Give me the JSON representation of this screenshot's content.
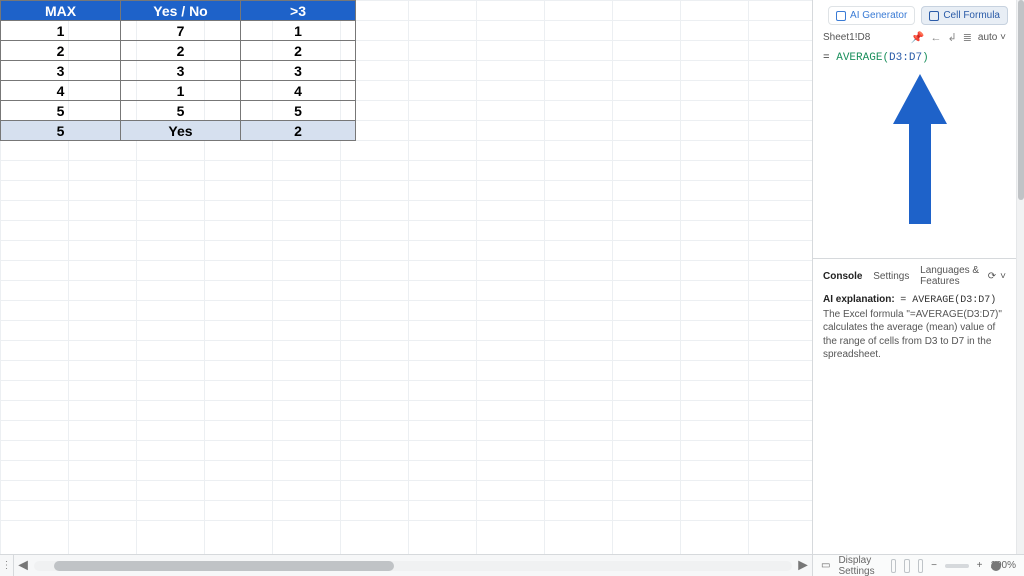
{
  "chart_data": {
    "type": "table",
    "headers": [
      "MAX",
      "Yes / No",
      ">3"
    ],
    "rows": [
      [
        "1",
        "7",
        "1"
      ],
      [
        "2",
        "2",
        "2"
      ],
      [
        "3",
        "3",
        "3"
      ],
      [
        "4",
        "1",
        "4"
      ],
      [
        "5",
        "5",
        "5"
      ],
      [
        "5",
        "Yes",
        "2"
      ]
    ],
    "highlight_row_index": 5
  },
  "side_panel": {
    "tabs": {
      "ai": "AI Generator",
      "cf": "Cell Formula"
    },
    "cell_ref": "Sheet1!D8",
    "auto_label": "auto",
    "formula": {
      "eq": "=",
      "fn": "AVERAGE",
      "open": "(",
      "arg": "D3:D7",
      "close": ")"
    },
    "console_tabs": {
      "console": "Console",
      "settings": "Settings",
      "lang": "Languages & Features"
    },
    "ai_explanation": {
      "label": "AI explanation:",
      "formula": "= AVERAGE(D3:D7)",
      "text": "The Excel formula \"=AVERAGE(D3:D7)\" calculates the average (mean) value of the range of cells from D3 to D7 in the spreadsheet."
    }
  },
  "status_bar": {
    "display_settings": "Display Settings",
    "zoom": "100%"
  }
}
